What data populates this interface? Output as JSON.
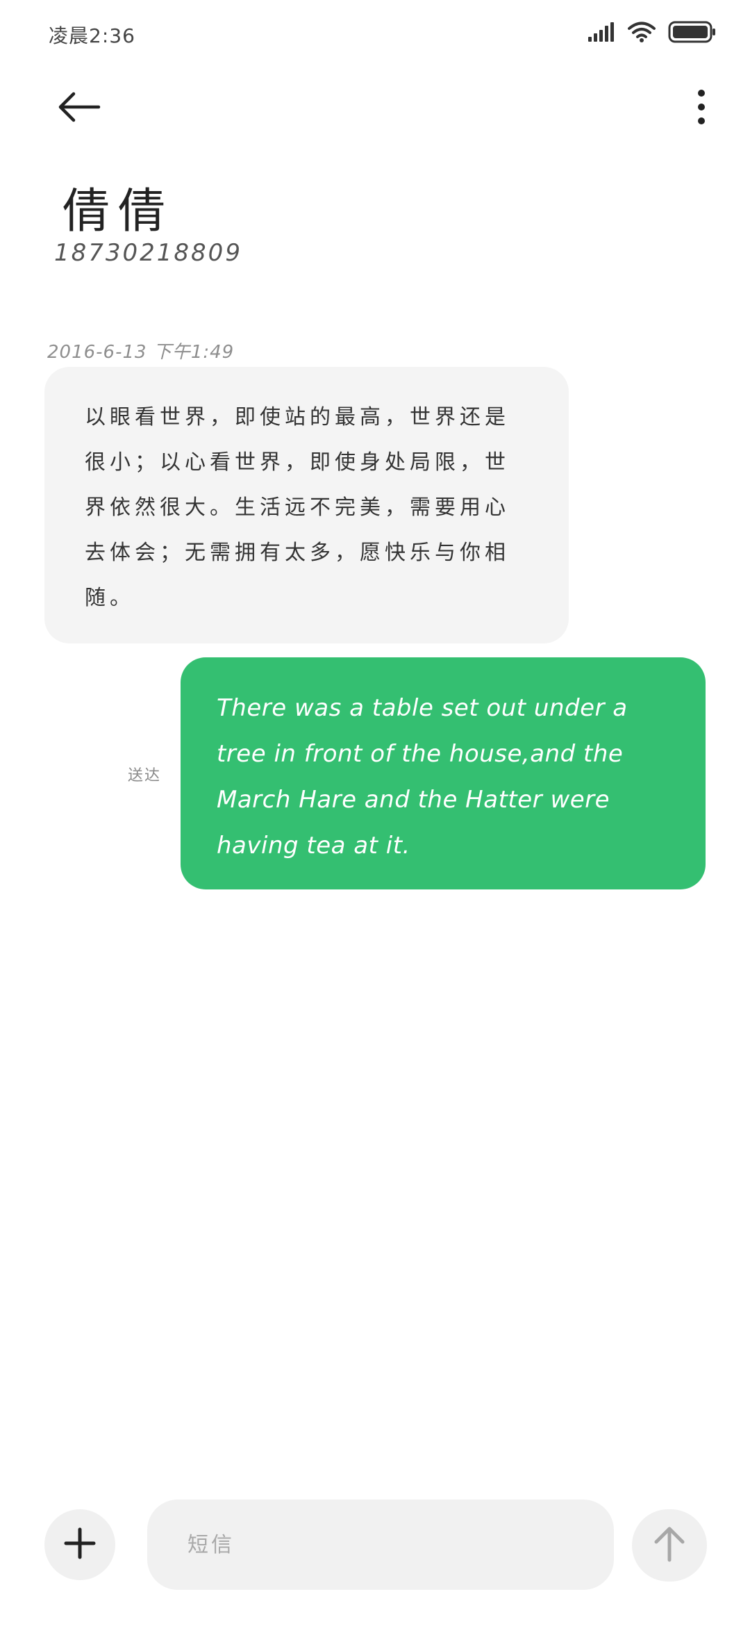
{
  "status_bar": {
    "time": "凌晨2:36",
    "signal_icon": "cellular-signal-icon",
    "wifi_icon": "wifi-icon",
    "battery_icon": "battery-icon"
  },
  "header": {
    "back_icon": "arrow-left-icon",
    "more_icon": "more-vertical-icon"
  },
  "contact": {
    "name": "倩倩",
    "number": "18730218809"
  },
  "conversation": {
    "timestamp": "2016-6-13 下午1:49",
    "incoming": {
      "text": "以眼看世界，即使站的最高，世界还是很小；以心看世界，即使身处局限，世界依然很大。生活远不完美，需要用心去体会；无需拥有太多，愿快乐与你相随。"
    },
    "outgoing": {
      "text": "There was a table set out under a tree in front of the house,and the March Hare and the Hatter were having tea at it.",
      "status": "送达"
    }
  },
  "composer": {
    "add_icon": "plus-icon",
    "placeholder": "短信",
    "value": "",
    "send_icon": "arrow-up-icon"
  },
  "colors": {
    "outgoing_bubble": "#34bf71",
    "incoming_bubble": "#f4f4f4",
    "background": "#ffffff"
  }
}
